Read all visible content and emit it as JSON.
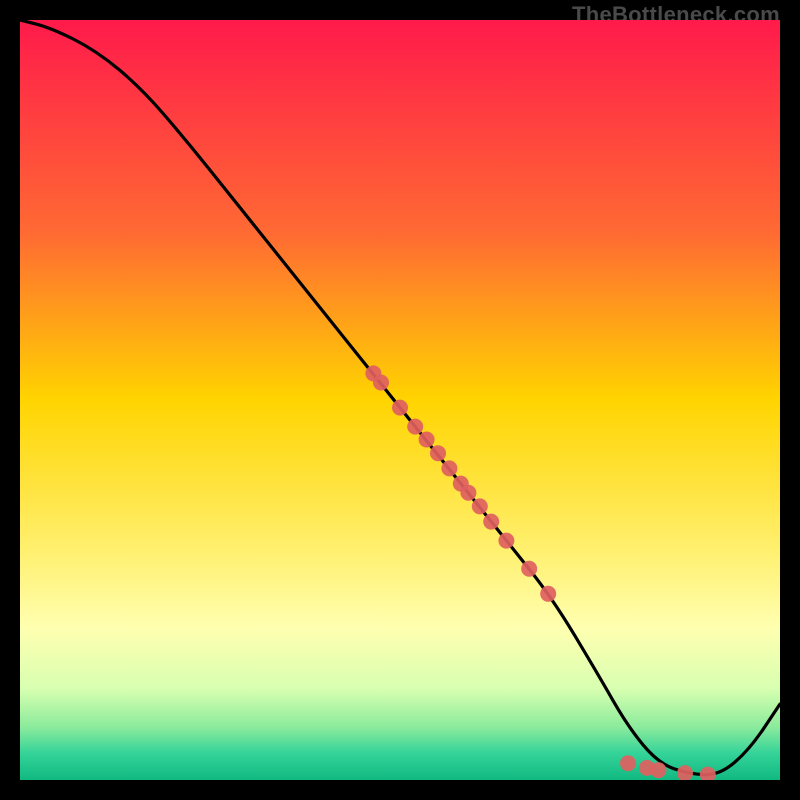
{
  "watermark": "TheBottleneck.com",
  "chart_data": {
    "type": "line",
    "title": "",
    "xlabel": "",
    "ylabel": "",
    "xlim": [
      0,
      100
    ],
    "ylim": [
      0,
      100
    ],
    "background_gradient": {
      "stops": [
        {
          "offset": 0.0,
          "color": "#ff1a4b"
        },
        {
          "offset": 0.28,
          "color": "#ff6a33"
        },
        {
          "offset": 0.5,
          "color": "#ffd400"
        },
        {
          "offset": 0.7,
          "color": "#fff070"
        },
        {
          "offset": 0.8,
          "color": "#ffffb0"
        },
        {
          "offset": 0.88,
          "color": "#d8ffb0"
        },
        {
          "offset": 0.93,
          "color": "#8CEB9C"
        },
        {
          "offset": 0.965,
          "color": "#34d399"
        },
        {
          "offset": 1.0,
          "color": "#10b981"
        }
      ]
    },
    "series": [
      {
        "name": "curve",
        "x": [
          0,
          4,
          10,
          16,
          22,
          28,
          34,
          40,
          46,
          52,
          58,
          64,
          70,
          76,
          80,
          84,
          88,
          92,
          96,
          100
        ],
        "y": [
          100,
          99,
          96,
          91,
          84,
          76.5,
          69,
          61.5,
          54,
          46.5,
          39,
          31.5,
          24,
          14,
          7,
          2.2,
          0.8,
          0.6,
          4,
          10
        ]
      }
    ],
    "scatter": [
      {
        "x": 46.5,
        "y": 53.5
      },
      {
        "x": 47.5,
        "y": 52.3
      },
      {
        "x": 50.0,
        "y": 49.0
      },
      {
        "x": 52.0,
        "y": 46.5
      },
      {
        "x": 53.5,
        "y": 44.8
      },
      {
        "x": 55.0,
        "y": 43.0
      },
      {
        "x": 56.5,
        "y": 41.0
      },
      {
        "x": 58.0,
        "y": 39.0
      },
      {
        "x": 59.0,
        "y": 37.8
      },
      {
        "x": 60.5,
        "y": 36.0
      },
      {
        "x": 62.0,
        "y": 34.0
      },
      {
        "x": 64.0,
        "y": 31.5
      },
      {
        "x": 67.0,
        "y": 27.8
      },
      {
        "x": 69.5,
        "y": 24.5
      },
      {
        "x": 80.0,
        "y": 2.2
      },
      {
        "x": 82.5,
        "y": 1.6
      },
      {
        "x": 84.0,
        "y": 1.3
      },
      {
        "x": 87.5,
        "y": 0.9
      },
      {
        "x": 90.5,
        "y": 0.7
      }
    ],
    "scatter_color": "#e06060",
    "line_color": "#000000"
  }
}
